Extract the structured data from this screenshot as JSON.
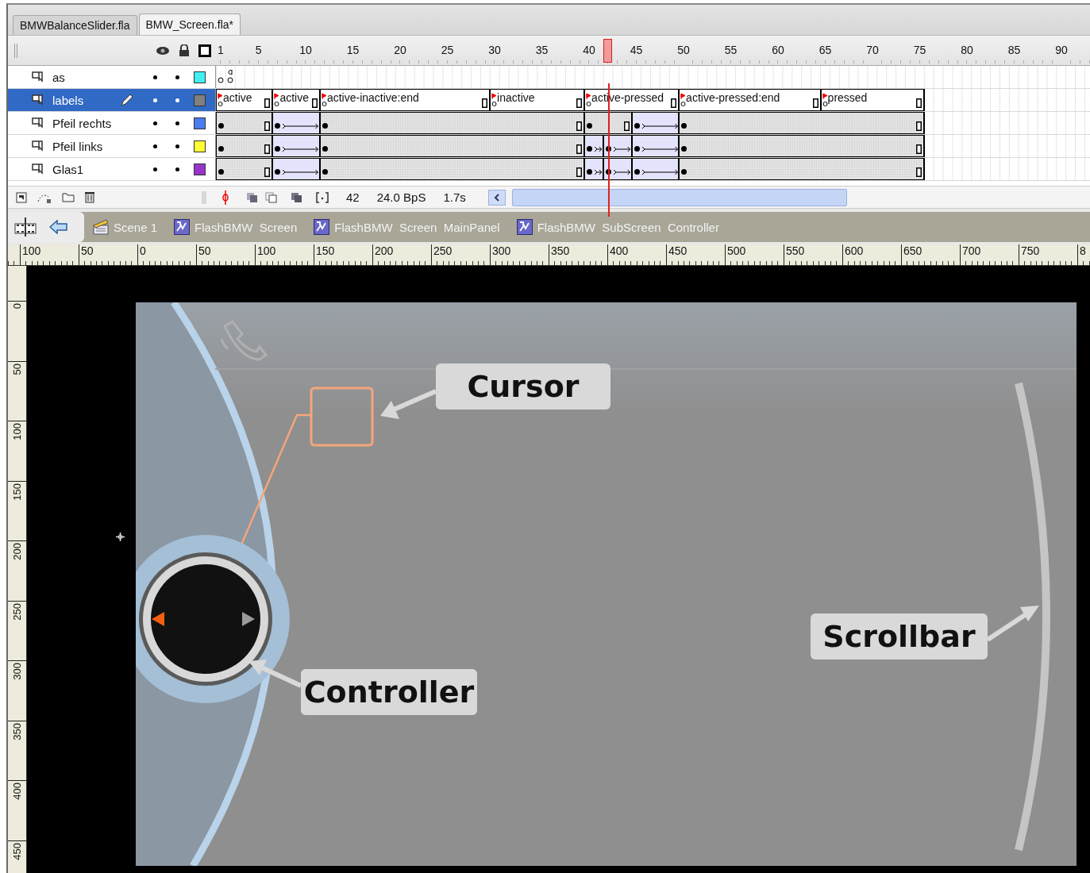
{
  "tabs": [
    {
      "label": "BMWBalanceSlider.fla",
      "selected": false
    },
    {
      "label": "BMW_Screen.fla*",
      "selected": true
    }
  ],
  "timeline": {
    "frame_numbers": [
      "1",
      "5",
      "10",
      "15",
      "20",
      "25",
      "30",
      "35",
      "40",
      "45",
      "50",
      "55",
      "60",
      "65",
      "70",
      "75",
      "80",
      "85",
      "90"
    ],
    "layers": [
      {
        "name": "as",
        "kind": "script",
        "color": "#40f0f0",
        "selected": false,
        "editing": false
      },
      {
        "name": "labels",
        "kind": "labels",
        "color": "#808080",
        "selected": true,
        "editing": true,
        "frame_labels": [
          "active",
          "active",
          "active-inactive:end",
          "inactive",
          "active-pressed",
          "active-pressed:end",
          "pressed"
        ]
      },
      {
        "name": "Pfeil rechts",
        "kind": "tween",
        "color": "#4a7cf0",
        "selected": false,
        "editing": false,
        "segments": [
          {
            "tween": false
          },
          {
            "tween": true
          },
          {
            "tween": false
          },
          {
            "tween": false
          },
          {
            "tween": true
          },
          {
            "tween": false
          }
        ]
      },
      {
        "name": "Pfeil links",
        "kind": "tween",
        "color": "#ffff33",
        "selected": false,
        "editing": false,
        "segments": [
          {
            "tween": false
          },
          {
            "tween": true
          },
          {
            "tween": false
          },
          {
            "tween": true
          },
          {
            "tween": true
          },
          {
            "tween": true
          },
          {
            "tween": false
          }
        ]
      },
      {
        "name": "Glas1",
        "kind": "tween",
        "color": "#9933cc",
        "selected": false,
        "editing": false,
        "segments": [
          {
            "tween": false
          },
          {
            "tween": true
          },
          {
            "tween": false
          },
          {
            "tween": true
          },
          {
            "tween": true
          },
          {
            "tween": true
          },
          {
            "tween": false
          }
        ]
      }
    ],
    "current_frame": "42",
    "frame_rate": "24.0 BpS",
    "elapsed_time": "1.7s"
  },
  "breadcrumbs": [
    {
      "label": "Scene 1",
      "kind": "scene"
    },
    {
      "label": "FlashBMW  Screen",
      "kind": "symbol"
    },
    {
      "label": "FlashBMW  Screen  MainPanel",
      "kind": "symbol"
    },
    {
      "label": "FlashBMW  SubScreen  Controller",
      "kind": "symbol"
    }
  ],
  "rulers": {
    "horizontal": [
      "100",
      "50",
      "0",
      "50",
      "100",
      "150",
      "200",
      "250",
      "300",
      "350",
      "400",
      "450",
      "500",
      "550",
      "600",
      "650",
      "700",
      "750",
      "8"
    ],
    "vertical": [
      "0",
      "50",
      "100",
      "150",
      "200",
      "250",
      "300",
      "350",
      "400",
      "450"
    ]
  },
  "stage": {
    "callouts": [
      {
        "label": "Cursor"
      },
      {
        "label": "Controller"
      },
      {
        "label": "Scrollbar"
      }
    ]
  }
}
